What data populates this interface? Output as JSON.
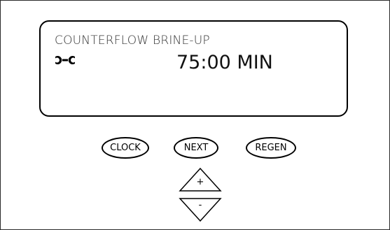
{
  "display": {
    "mode_text": "COUNTERFLOW BRINE-UP",
    "status_icon": "wrench-icon",
    "value_text": "75:00 MIN"
  },
  "buttons": {
    "clock_label": "CLOCK",
    "next_label": "NEXT",
    "regen_label": "REGEN",
    "up_label": "+",
    "down_label": "-"
  }
}
